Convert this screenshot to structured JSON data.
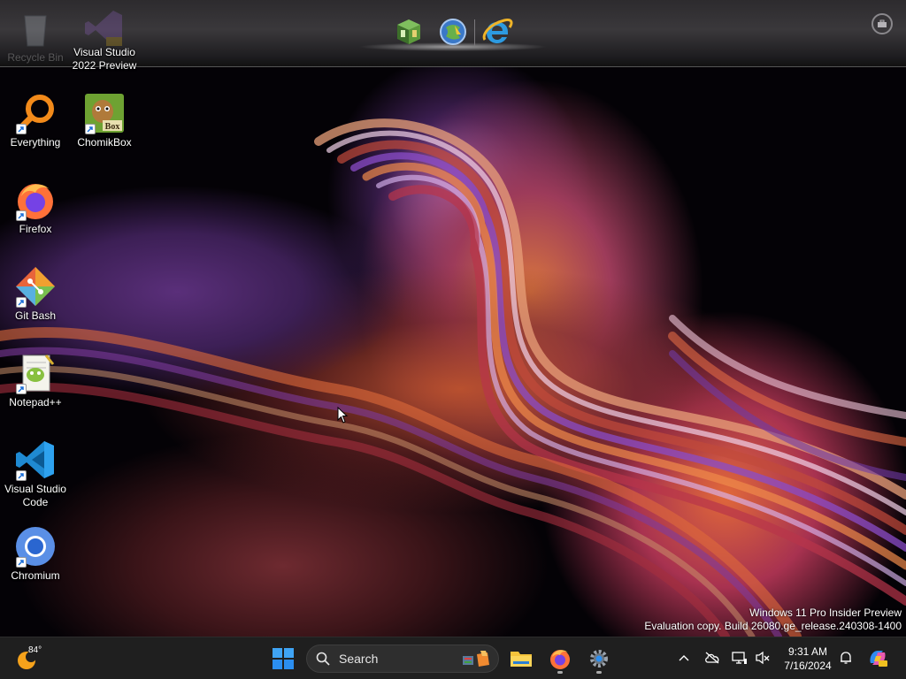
{
  "top_dock": {
    "items": [
      {
        "name": "app-1-icon"
      },
      {
        "name": "app-2-icon"
      },
      {
        "name": "internet-explorer-icon"
      }
    ]
  },
  "desktop_icons": [
    {
      "id": "recycle-bin",
      "label": "Recycle Bin"
    },
    {
      "id": "visual-studio-2022",
      "label": "Visual Studio\n2022 Preview"
    },
    {
      "id": "everything",
      "label": "Everything"
    },
    {
      "id": "chomikbox",
      "label": "ChomikBox"
    },
    {
      "id": "firefox",
      "label": "Firefox"
    },
    {
      "id": "git-bash",
      "label": "Git Bash"
    },
    {
      "id": "notepadpp",
      "label": "Notepad++"
    },
    {
      "id": "vscode",
      "label": "Visual Studio\nCode"
    },
    {
      "id": "chromium",
      "label": "Chromium"
    }
  ],
  "watermark": {
    "line1": "Windows 11 Pro Insider Preview",
    "line2": "Evaluation copy. Build 26080.ge_release.240308-1400"
  },
  "taskbar": {
    "weather_temp": "84°",
    "search_placeholder": "Search",
    "pinned": [
      "start-icon",
      "file-explorer-icon",
      "firefox-icon",
      "settings-icon"
    ]
  },
  "tray": {
    "time": "9:31 AM",
    "date": "7/16/2024"
  },
  "colors": {
    "taskbar_bg": "#1f1f1f",
    "windows_blue": "#2b8ef0",
    "firefox_orange": "#ff7139"
  }
}
